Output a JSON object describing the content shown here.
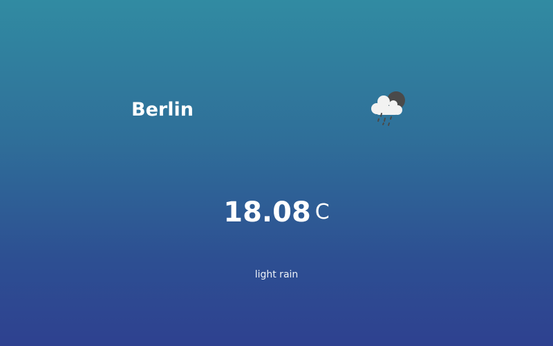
{
  "weather": {
    "city": "Berlin",
    "icon": "night-cloud-rain-icon",
    "temperature": "18.08",
    "unit": "C",
    "description": "light rain"
  },
  "colors": {
    "background_top": "#318ba2",
    "background_bottom": "#2e4190",
    "text": "#ffffff",
    "moon": "#4a4a4a",
    "cloud": "#f2f2f2",
    "rain": "#4a4a4a"
  }
}
